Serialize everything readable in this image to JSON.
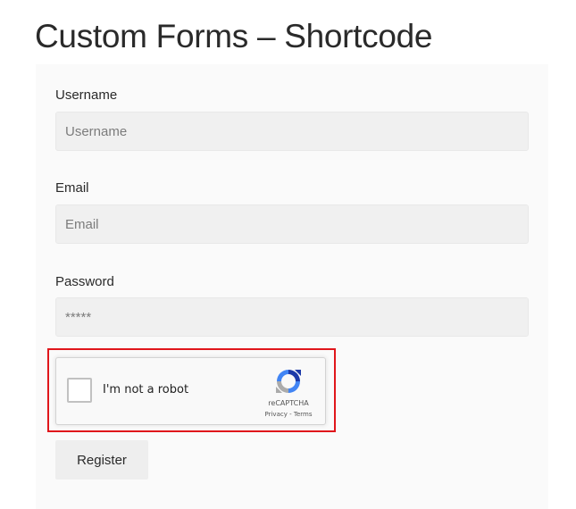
{
  "page": {
    "title": "Custom Forms – Shortcode"
  },
  "form": {
    "fields": [
      {
        "label": "Username",
        "placeholder": "Username",
        "value": ""
      },
      {
        "label": "Email",
        "placeholder": "Email",
        "value": ""
      },
      {
        "label": "Password",
        "placeholder": "*****",
        "value": ""
      }
    ],
    "recaptcha": {
      "checkbox_label": "I'm not a robot",
      "brand": "reCAPTCHA",
      "privacy_link": "Privacy",
      "separator": " - ",
      "terms_link": "Terms",
      "checked": false,
      "highlight_color": "#e0161b"
    },
    "register_label": "Register"
  }
}
